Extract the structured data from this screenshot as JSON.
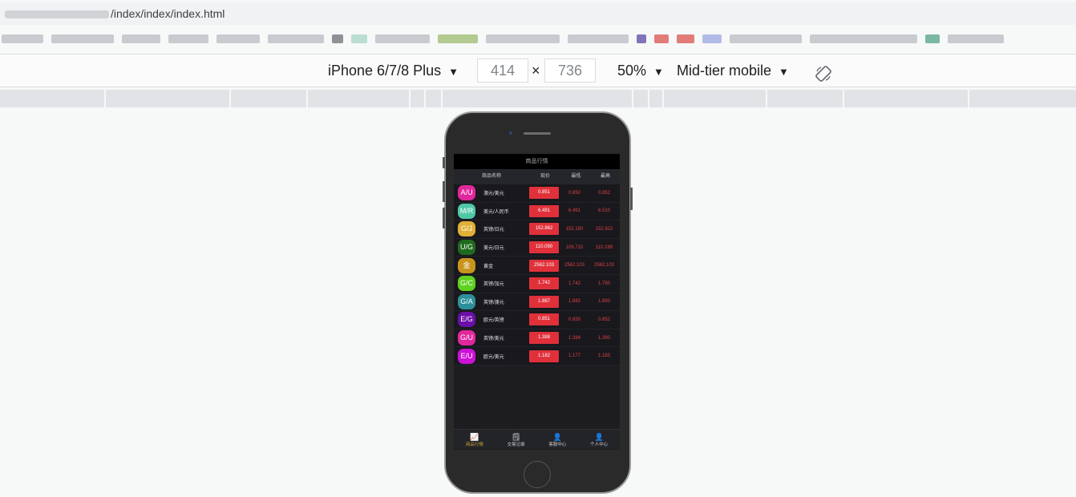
{
  "browser": {
    "url_path": "/index/index/index.html"
  },
  "devtools": {
    "device": "iPhone 6/7/8 Plus",
    "width": "414",
    "height": "736",
    "times": "×",
    "zoom": "50%",
    "throttle": "Mid-tier mobile",
    "dropdown_arrow": "▼",
    "rotate_icon": "rotate-icon"
  },
  "app": {
    "header_title": "商品行情",
    "columns": [
      "商品名称",
      "现价",
      "最低",
      "最高"
    ],
    "rows": [
      {
        "badge": "A/U",
        "color": "#e0289c",
        "name": "澳元/美元",
        "price": "0.851",
        "low": "0.850",
        "high": "0.852"
      },
      {
        "badge": "M/R",
        "color": "#4fc8a6",
        "name": "美元/人民币",
        "price": "6.491",
        "low": "6.491",
        "high": "6.510"
      },
      {
        "badge": "G/J",
        "color": "#e1b037",
        "name": "英镑/日元",
        "price": "152.862",
        "low": "152.150",
        "high": "152.922"
      },
      {
        "badge": "U/G",
        "color": "#1e6b1e",
        "name": "美元/日元",
        "price": "110.090",
        "low": "109.710",
        "high": "110.289"
      },
      {
        "badge": "金",
        "color": "#c8941c",
        "name": "黄金",
        "price": "2562.103",
        "low": "2562.103",
        "high": "2562.103"
      },
      {
        "badge": "G/C",
        "color": "#5fd11f",
        "name": "英镑/加元",
        "price": "1.742",
        "low": "1.742",
        "high": "1.750"
      },
      {
        "badge": "G/A",
        "color": "#2c8f99",
        "name": "英镑/澳元",
        "price": "1.887",
        "low": "1.882",
        "high": "1.893"
      },
      {
        "badge": "E/G",
        "color": "#6a0fa8",
        "name": "欧元/英镑",
        "price": "0.851",
        "low": "0.850",
        "high": "0.852"
      },
      {
        "badge": "G/U",
        "color": "#e0289c",
        "name": "英镑/美元",
        "price": "1.388",
        "low": "1.384",
        "high": "1.390"
      },
      {
        "badge": "E/U",
        "color": "#cc12d6",
        "name": "欧元/美元",
        "price": "1.182",
        "low": "1.177",
        "high": "1.183"
      }
    ],
    "tabs": [
      {
        "label": "商品行情",
        "icon": "chart-icon",
        "glyph": "📈"
      },
      {
        "label": "交易记录",
        "icon": "document-icon",
        "glyph": "🗒"
      },
      {
        "label": "客服中心",
        "icon": "user-icon",
        "glyph": "👤"
      },
      {
        "label": "个人中心",
        "icon": "user-icon",
        "glyph": "👤"
      }
    ]
  }
}
